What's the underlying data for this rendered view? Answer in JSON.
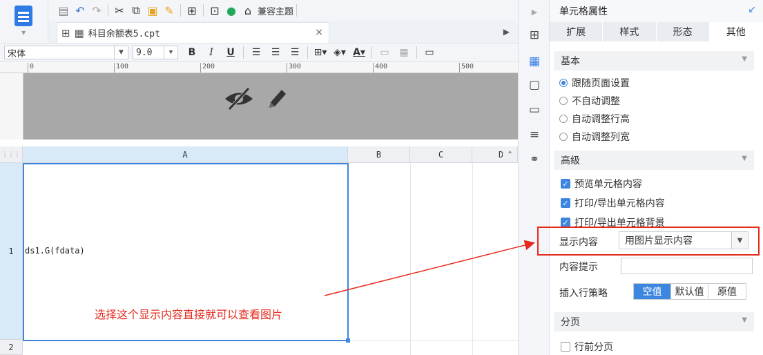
{
  "toolbar": {
    "theme_label": "兼容主题"
  },
  "tab": {
    "name": "科目余额表5.cpt",
    "close": "×"
  },
  "format": {
    "font_name": "宋体",
    "font_size": "9.0",
    "bold": "B",
    "italic": "I",
    "underline": "U",
    "font_color_glyph": "A"
  },
  "ruler": {
    "ticks": [
      "0",
      "100",
      "200",
      "300",
      "400",
      "500"
    ]
  },
  "sheet": {
    "columns": [
      "A",
      "B",
      "C",
      "D"
    ],
    "rows": [
      "1",
      "2"
    ],
    "cell_a1": "ds1.G(fdata)",
    "corner": "⋮⋮⋮"
  },
  "annotation": "选择这个显示内容直接就可以查看图片",
  "panel": {
    "title": "单元格属性",
    "tabs": [
      {
        "label": "扩展",
        "active": false
      },
      {
        "label": "样式",
        "active": false
      },
      {
        "label": "形态",
        "active": false
      },
      {
        "label": "其他",
        "active": true
      }
    ],
    "basic": {
      "header": "基本",
      "options": [
        {
          "label": "跟随页面设置",
          "selected": true
        },
        {
          "label": "不自动调整",
          "selected": false
        },
        {
          "label": "自动调整行高",
          "selected": false
        },
        {
          "label": "自动调整列宽",
          "selected": false
        }
      ]
    },
    "advanced": {
      "header": "高级",
      "checks": [
        {
          "label": "预览单元格内容",
          "checked": true
        },
        {
          "label": "打印/导出单元格内容",
          "checked": true
        },
        {
          "label": "打印/导出单元格背景",
          "checked": true
        }
      ],
      "display_label": "显示内容",
      "display_value": "用图片显示内容",
      "tooltip_label": "内容提示",
      "tooltip_value": "",
      "insert_label": "插入行策略",
      "insert_options": [
        {
          "label": "空值",
          "active": true
        },
        {
          "label": "默认值",
          "active": false
        },
        {
          "label": "原值",
          "active": false
        }
      ]
    },
    "paging": {
      "header": "分页",
      "checks": [
        {
          "label": "行前分页",
          "checked": false
        }
      ]
    }
  },
  "colors": {
    "accent": "#3d86e0",
    "annotation": "#e52a1d"
  }
}
